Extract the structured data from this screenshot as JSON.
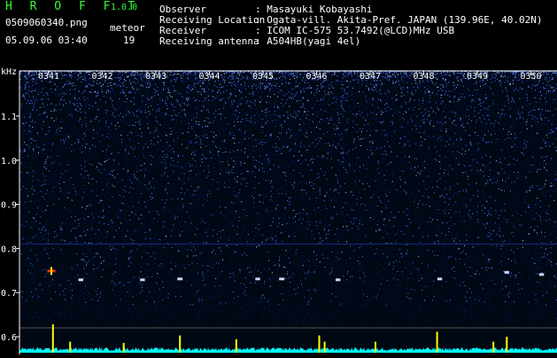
{
  "header": {
    "app_name": "H R O F F T",
    "version": "1.0.0",
    "filename": "0509060340.png",
    "meteor_label": "meteor",
    "meteor_count": "19",
    "datetime": "05.09.06 03:40",
    "meta": [
      {
        "key": "Observer",
        "value": ": Masayuki Kobayashi"
      },
      {
        "key": "Receiving Location",
        "value": ": Ogata-vill. Akita-Pref. JAPAN (139.96E, 40.02N)"
      },
      {
        "key": "Receiver",
        "value": ": ICOM IC-575 53.7492(@LCD)MHz USB"
      },
      {
        "key": "Receiving antenna",
        "value": ": A504HB(yagi 4el)"
      }
    ]
  },
  "chart_data": {
    "type": "heatmap",
    "ylabel": "kHz",
    "x_ticks": [
      "0341",
      "0342",
      "0343",
      "0344",
      "0345",
      "0346",
      "0347",
      "0348",
      "0349",
      "0350"
    ],
    "xlim": [
      0,
      10
    ],
    "y_ticks": [
      "0.6",
      "0.7",
      "0.8",
      "0.9",
      "1.0",
      "1.1"
    ],
    "ylim": [
      0.58,
      1.2
    ],
    "colors": {
      "background": "#000000",
      "noise_low": "#0a1560",
      "noise_high": "#4a7aff",
      "signal": "#ff3300",
      "tick": "#ffff00",
      "trace": "#00ffff"
    },
    "echo_bursts": [
      {
        "x": 0.05,
        "y": 0.748,
        "strength": 1.0
      },
      {
        "x": 0.6,
        "y": 0.728,
        "strength": 0.4
      },
      {
        "x": 1.75,
        "y": 0.728,
        "strength": 0.4
      },
      {
        "x": 2.45,
        "y": 0.73,
        "strength": 0.5
      },
      {
        "x": 3.9,
        "y": 0.73,
        "strength": 0.4
      },
      {
        "x": 4.35,
        "y": 0.73,
        "strength": 0.5
      },
      {
        "x": 5.4,
        "y": 0.728,
        "strength": 0.4
      },
      {
        "x": 7.3,
        "y": 0.73,
        "strength": 0.4
      },
      {
        "x": 8.55,
        "y": 0.745,
        "strength": 0.4
      },
      {
        "x": 9.2,
        "y": 0.74,
        "strength": 0.4
      },
      {
        "x": 9.75,
        "y": 0.735,
        "strength": 1.0
      }
    ],
    "activity_spikes": [
      {
        "x": 0.08,
        "h": 1.0
      },
      {
        "x": 0.4,
        "h": 0.3
      },
      {
        "x": 1.4,
        "h": 0.25
      },
      {
        "x": 2.45,
        "h": 0.55
      },
      {
        "x": 3.5,
        "h": 0.4
      },
      {
        "x": 5.05,
        "h": 0.55
      },
      {
        "x": 5.15,
        "h": 0.3
      },
      {
        "x": 6.1,
        "h": 0.3
      },
      {
        "x": 7.25,
        "h": 0.7
      },
      {
        "x": 8.3,
        "h": 0.3
      },
      {
        "x": 8.55,
        "h": 0.5
      },
      {
        "x": 9.75,
        "h": 1.0
      }
    ]
  }
}
